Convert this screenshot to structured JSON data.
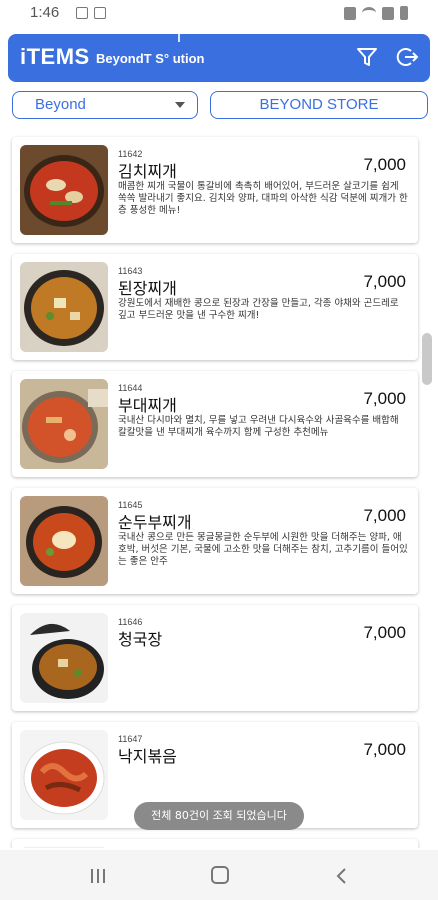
{
  "status_bar": {
    "time": "1:46"
  },
  "app_bar": {
    "title": "iTEMS",
    "subtitle": "BeyondT S° ution"
  },
  "filters": {
    "selected_store": "Beyond",
    "store_button": "BEYOND STORE"
  },
  "items": [
    {
      "code": "11642",
      "name": "김치찌개",
      "price": "7,000",
      "desc": "매콤한 찌개 국물이 통갈비에 촉촉히 배어있어, 부드러운 살코기를 쉽게 쏙쏙 발라내기 좋지요. 김치와 양파, 대파의 아삭한 식감 덕분에 찌개가 한층 풍성한 메뉴!"
    },
    {
      "code": "11643",
      "name": "된장찌개",
      "price": "7,000",
      "desc": "강원도에서 재배한 콩으로 된장과 간장을 만들고, 각종 야채와 곤드레로 깊고 부드러운 맛을 낸 구수한 찌개!"
    },
    {
      "code": "11644",
      "name": "부대찌개",
      "price": "7,000",
      "desc": "국내산 다시마와 멸치, 무를 넣고 우려낸 다시육수와 사골육수를 배합해 칼칼맛을 낸 부대찌개 육수까지 함께 구성한 추천메뉴"
    },
    {
      "code": "11645",
      "name": "순두부찌개",
      "price": "7,000",
      "desc": "국내산 콩으로 만든 몽글몽글한 순두부에 시원한 맛을 더해주는 양파, 애호박, 버섯은 기본, 국물에 고소한 맛을 더해주는 참치, 고추기름이 들어있는 좋은 안주"
    },
    {
      "code": "11646",
      "name": "청국장",
      "price": "7,000",
      "desc": ""
    },
    {
      "code": "11647",
      "name": "낙지볶음",
      "price": "7,000",
      "desc": ""
    }
  ],
  "toast": "전체 80건이 조회 되었습니다",
  "icons": {
    "filter": "filter-icon",
    "logout": "logout-icon",
    "nav_recent": "recent-apps-icon",
    "nav_home": "home-icon",
    "nav_back": "back-icon"
  },
  "colors": {
    "primary": "#3a6fe0",
    "toast_bg": "#8a8a8a"
  }
}
